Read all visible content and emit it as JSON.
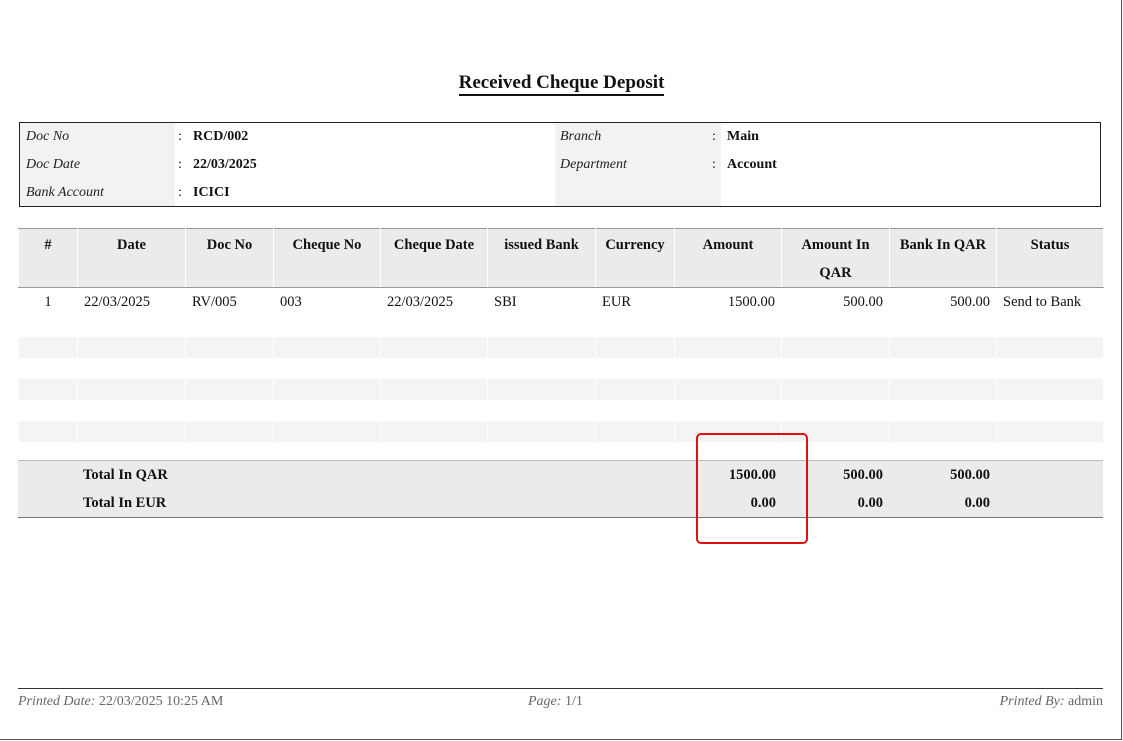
{
  "title": "Received Cheque Deposit",
  "info": {
    "doc_no_label": "Doc No",
    "doc_no": "RCD/002",
    "doc_date_label": "Doc Date",
    "doc_date": "22/03/2025",
    "bank_account_label": "Bank Account",
    "bank_account": "ICICI",
    "branch_label": "Branch",
    "branch": "Main",
    "department_label": "Department",
    "department": "Account",
    "separator": ":"
  },
  "table": {
    "headers": [
      "#",
      "Date",
      "Doc No",
      "Cheque No",
      "Cheque Date",
      "issued Bank",
      "Currency",
      "Amount",
      "Amount In QAR",
      "Bank In QAR",
      "Status"
    ],
    "rows": [
      [
        "1",
        "22/03/2025",
        "RV/005",
        "003",
        "22/03/2025",
        "SBI",
        "EUR",
        "1500.00",
        "500.00",
        "500.00",
        "Send to Bank"
      ]
    ]
  },
  "totals": {
    "qar_label": "Total In QAR",
    "qar_amount": "1500.00",
    "qar_amount_in_qar": "500.00",
    "qar_bank_in_qar": "500.00",
    "eur_label": "Total In EUR",
    "eur_amount": "0.00",
    "eur_amount_in_qar": "0.00",
    "eur_bank_in_qar": "0.00"
  },
  "footer": {
    "printed_date_label": "Printed Date:",
    "printed_date": "22/03/2025 10:25 AM",
    "page_label": "Page:",
    "page": "1/1",
    "printed_by_label": "Printed By:",
    "printed_by": "admin"
  },
  "colors": {
    "highlight": "#e01010",
    "header_bg": "#ebebeb"
  }
}
